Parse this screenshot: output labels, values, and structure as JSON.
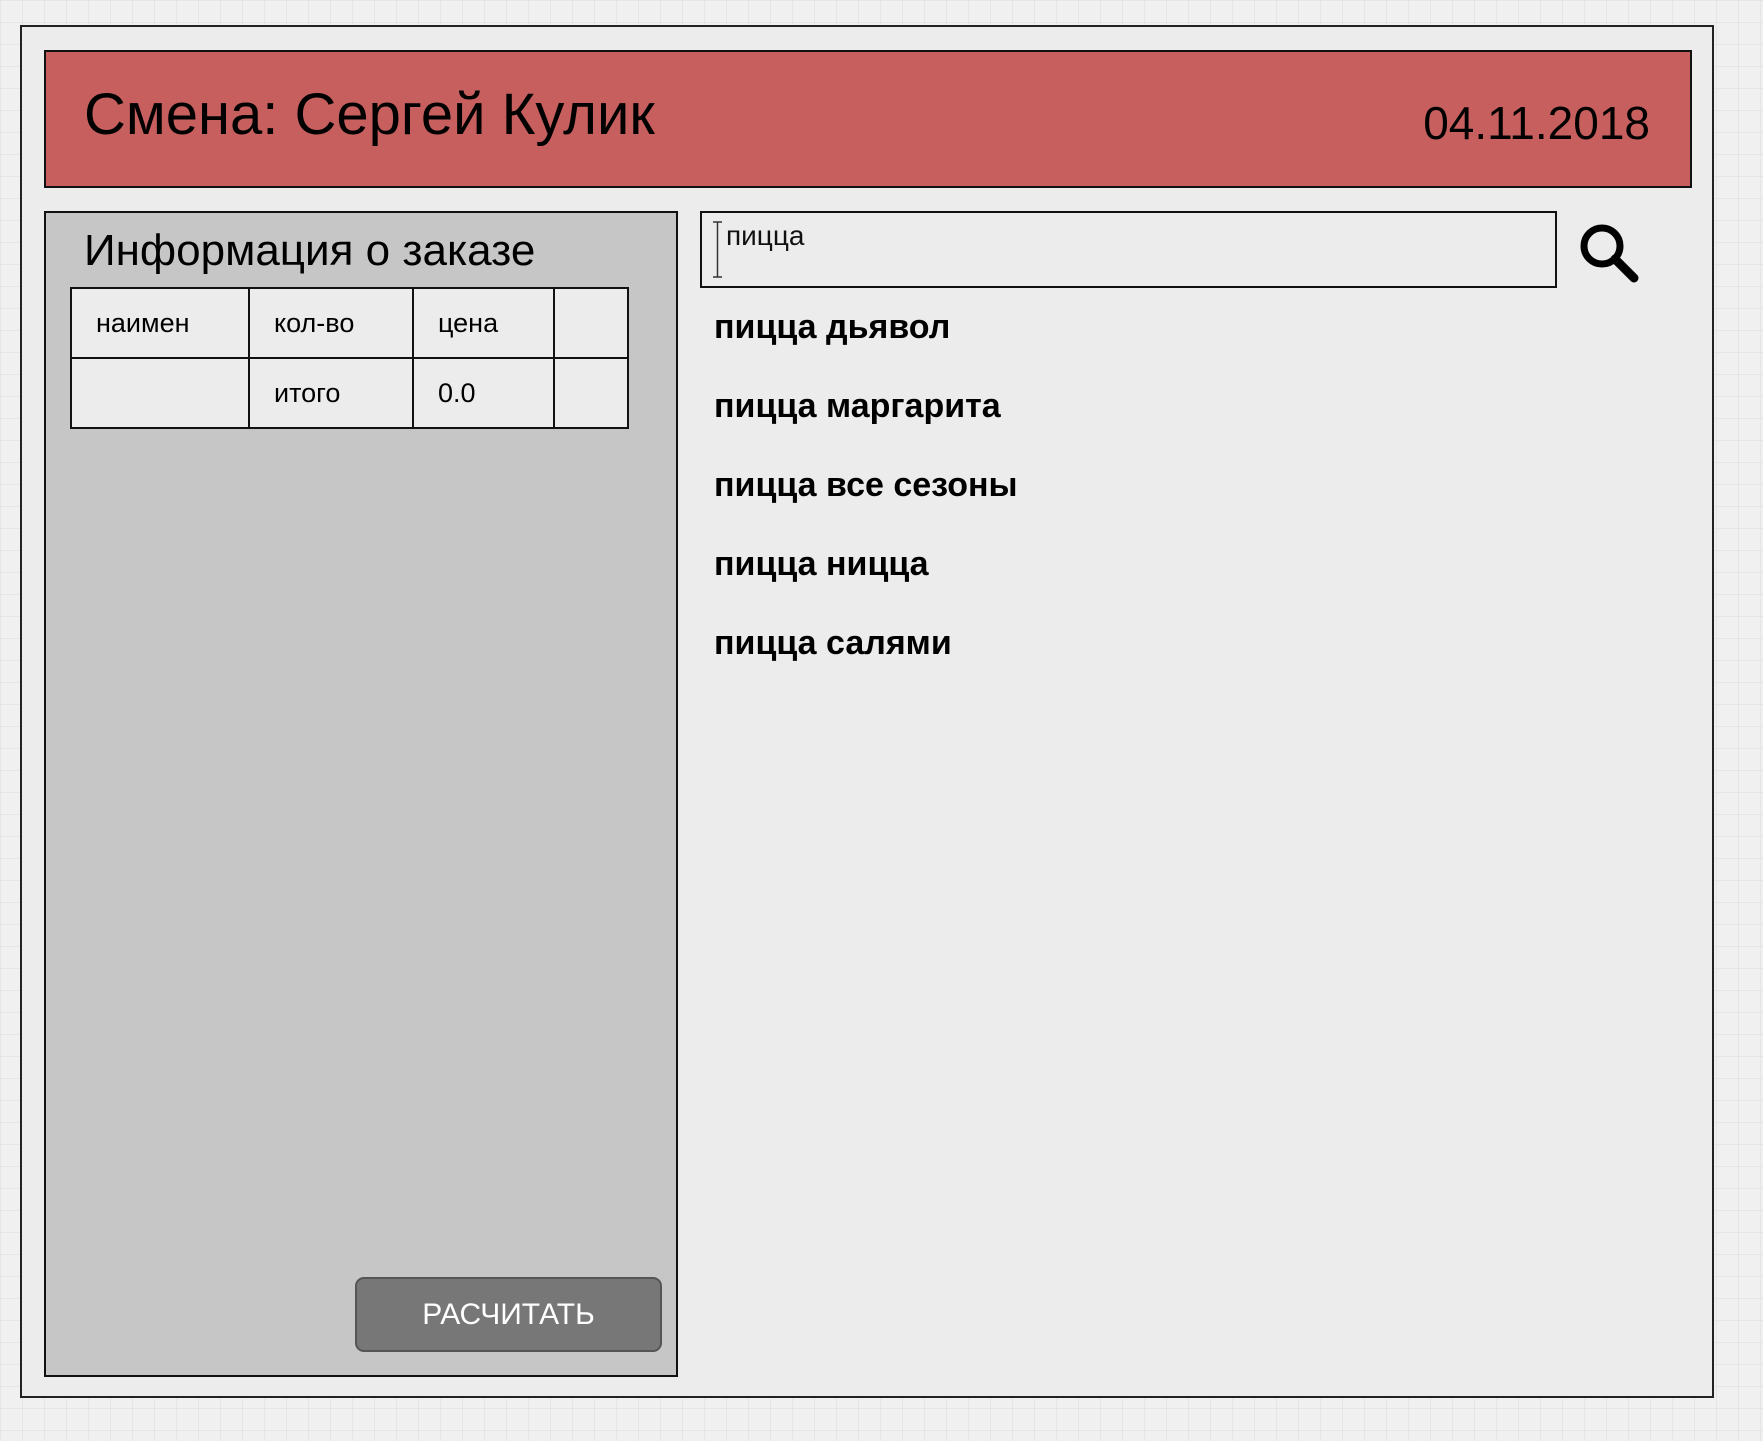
{
  "header": {
    "shift_label": "Смена: Сергей Кулик",
    "date": "04.11.2018",
    "background_color": "#c75f5f"
  },
  "order_info": {
    "title": "Информация о заказе",
    "columns": [
      "наимен",
      "кол-во",
      "цена",
      ""
    ],
    "total_row": {
      "name": "",
      "label": "итого",
      "value": "0.0",
      "extra": ""
    },
    "calculate_button_label": "РАСЧИТАТЬ"
  },
  "search": {
    "value": "пицца",
    "icon": "search-icon",
    "results": [
      "пицца дьявол",
      "пицца маргарита",
      "пицца все сезоны",
      "пицца ницца",
      "пицца салями"
    ]
  }
}
